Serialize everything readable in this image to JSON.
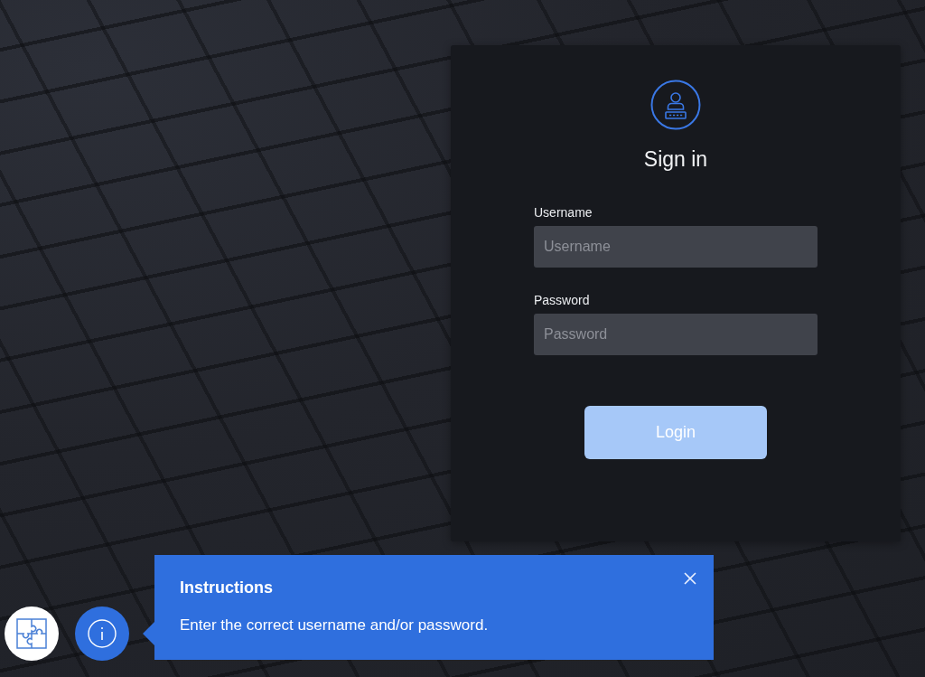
{
  "login_card": {
    "title": "Sign in",
    "fields": [
      {
        "label": "Username",
        "placeholder": "Username"
      },
      {
        "label": "Password",
        "placeholder": "Password"
      }
    ],
    "submit_button": {
      "label": "Login",
      "disabled": true
    }
  },
  "help_widget": {
    "popover": {
      "title": "Instructions",
      "text": "Enter the correct username and/or password."
    }
  }
}
